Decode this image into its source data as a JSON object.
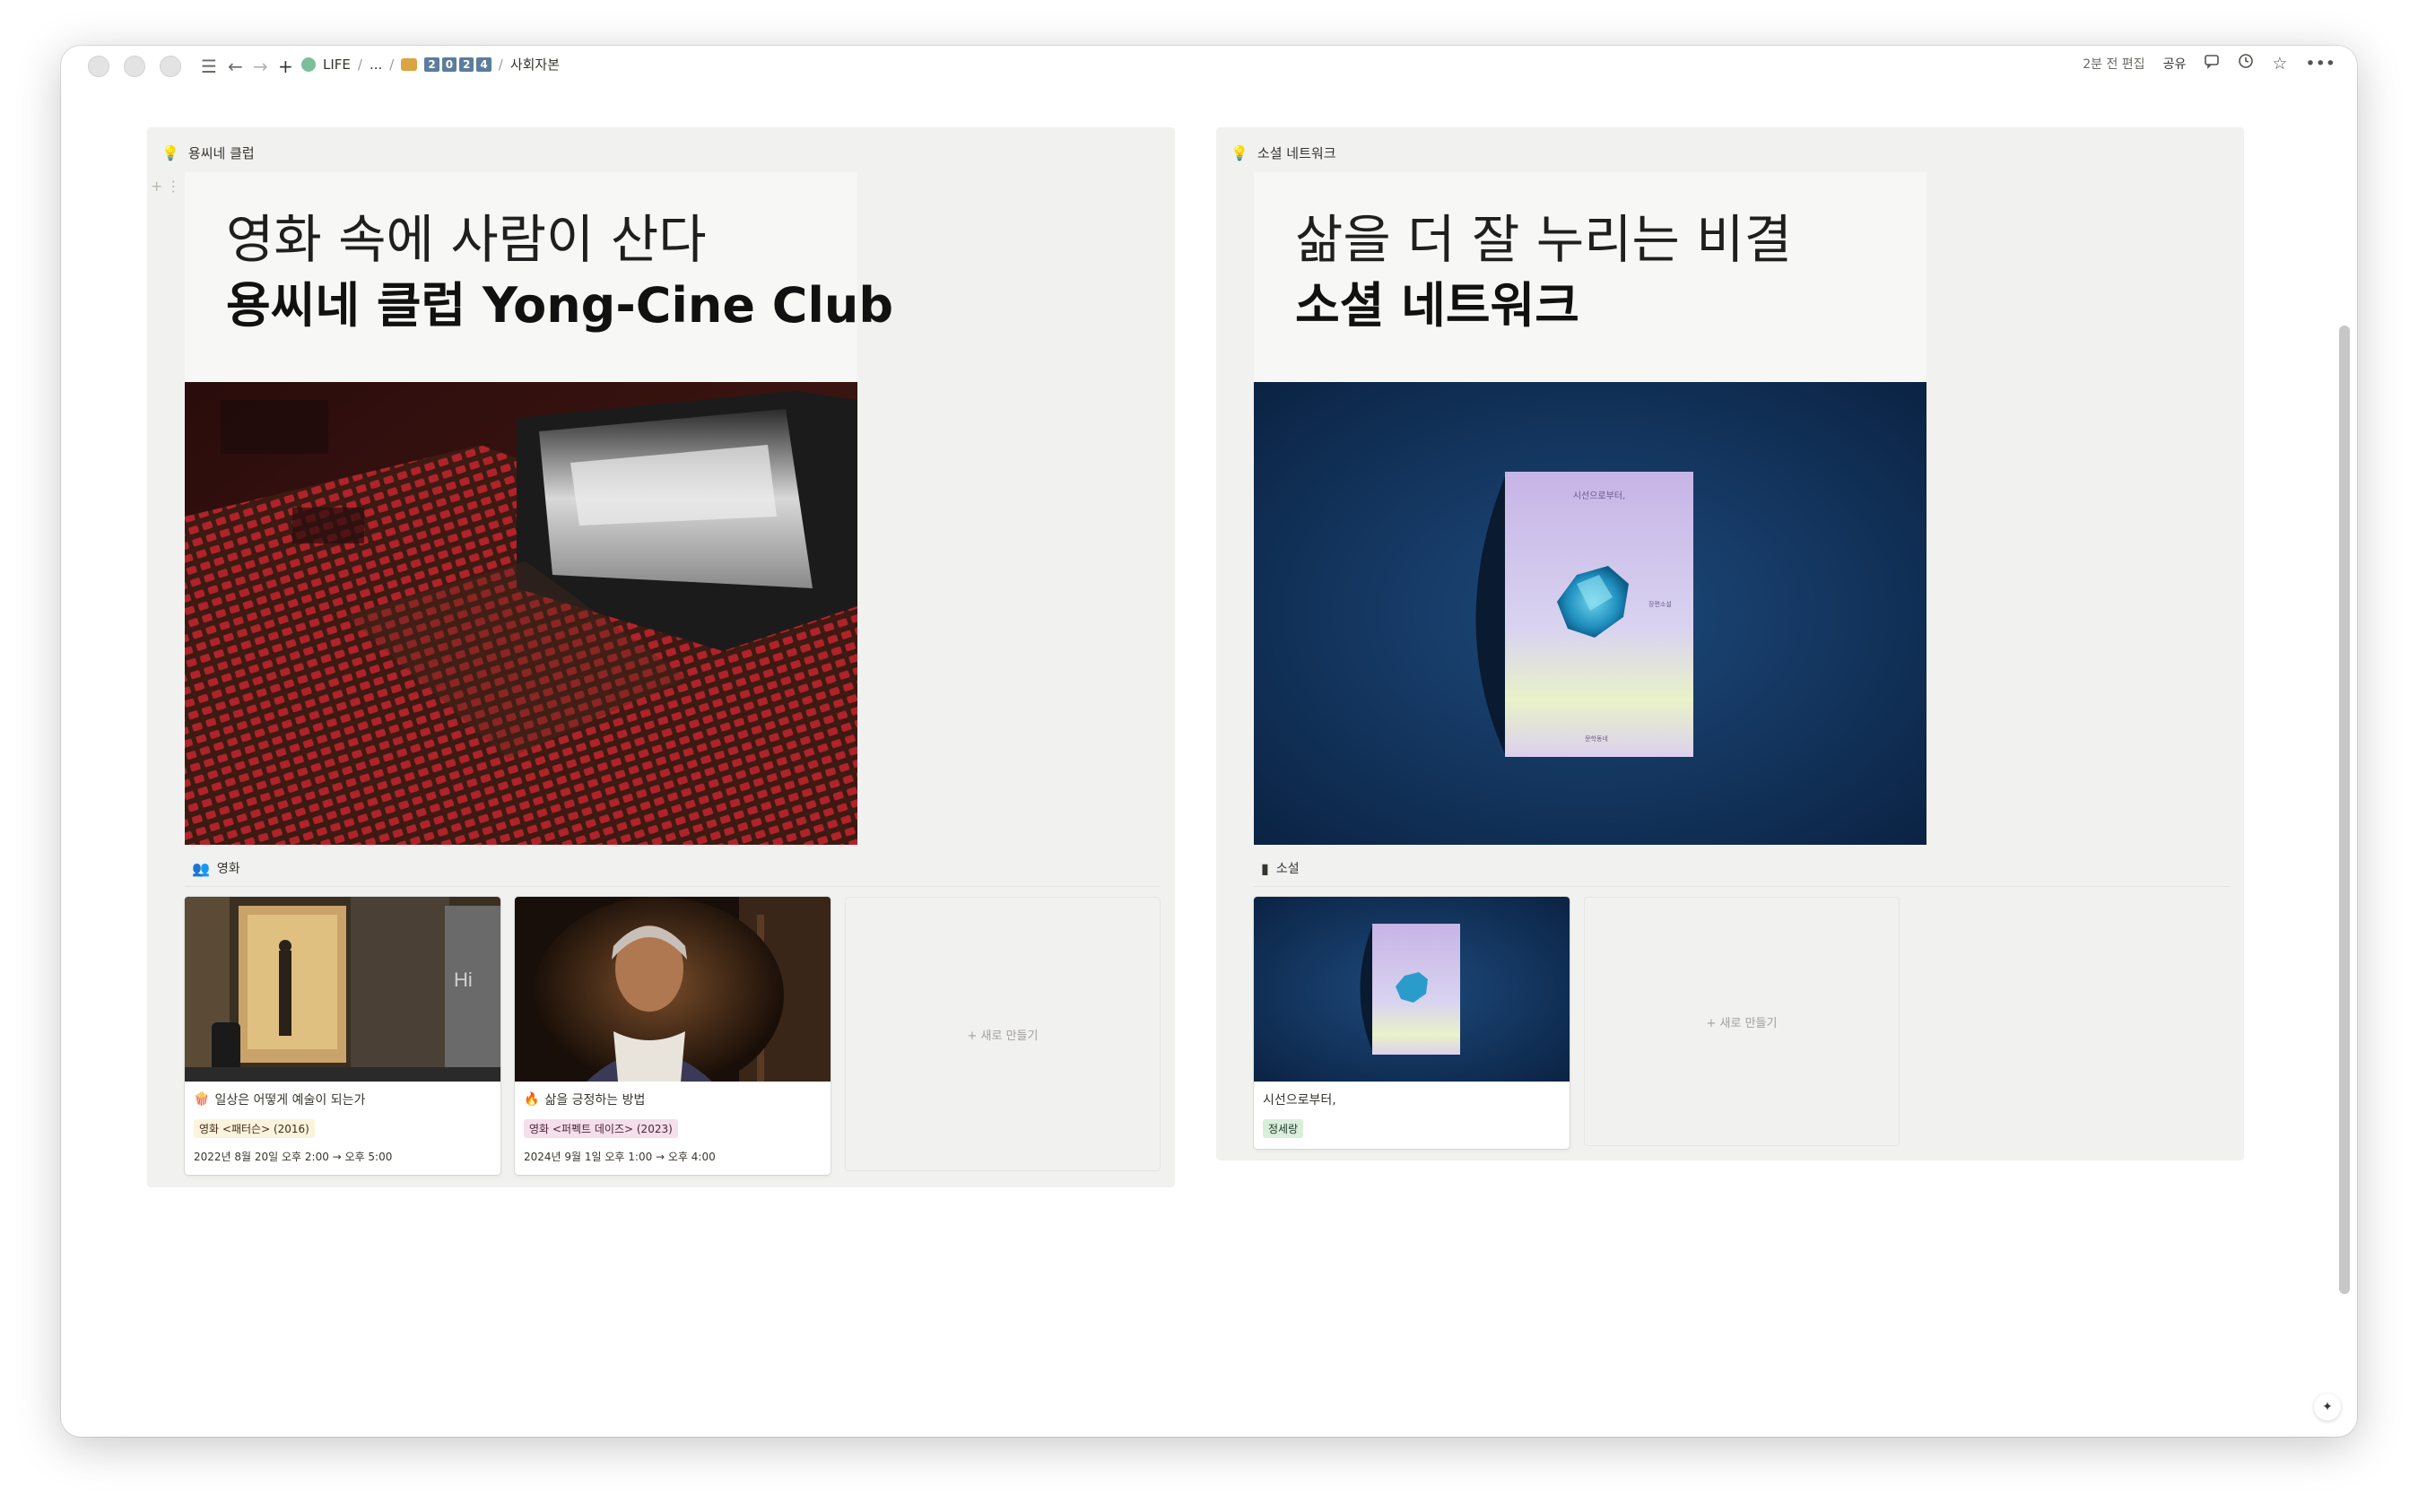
{
  "topbar": {
    "breadcrumbs": {
      "life": "LIFE",
      "sep1": "/",
      "ellipsis": "...",
      "sep2": "/",
      "year_digits": [
        "2",
        "0",
        "2",
        "4"
      ],
      "sep3": "/",
      "current": "사회자본"
    },
    "edited": "2분 전 편집",
    "share": "공유"
  },
  "left": {
    "title": "용씨네 클럽",
    "hero_line1": "영화 속에 사람이 산다",
    "hero_line2": "용씨네 클럽 Yong-Cine Club",
    "section_label": "영화",
    "cards": [
      {
        "title": "일상은 어떻게 예술이 되는가",
        "tag": "영화 <패터슨> (2016)",
        "date": "2022년 8월 20일 오후 2:00 → 오후 5:00"
      },
      {
        "title": "삶을 긍정하는 방법",
        "tag": "영화 <퍼펙트 데이즈> (2023)",
        "date": "2024년 9월 1일 오후 1:00 → 오후 4:00"
      }
    ],
    "new_label": "+ 새로 만들기"
  },
  "right": {
    "title": "소셜 네트워크",
    "hero_line1": "삶을 더 잘 누리는 비결",
    "hero_line2": "소셜 네트워크",
    "section_label": "소설",
    "cards": [
      {
        "title": "시선으로부터,",
        "tag": "정세랑"
      }
    ],
    "new_label": "+ 새로 만들기"
  },
  "colors": {
    "panel_bg": "#f1f1ef",
    "tag_yellow": "#fbf3db",
    "tag_pink": "#f4dfeb",
    "tag_green": "#dbeddb",
    "crumb_pill": "#5c7d9c"
  },
  "icons": [
    "menu-icon",
    "back-arrow-icon",
    "forward-arrow-icon",
    "plus-icon",
    "comment-icon",
    "clock-icon",
    "star-icon",
    "more-icon",
    "bulb-icon",
    "people-icon",
    "book-icon",
    "popcorn-icon",
    "fire-icon",
    "sparkle-icon"
  ]
}
